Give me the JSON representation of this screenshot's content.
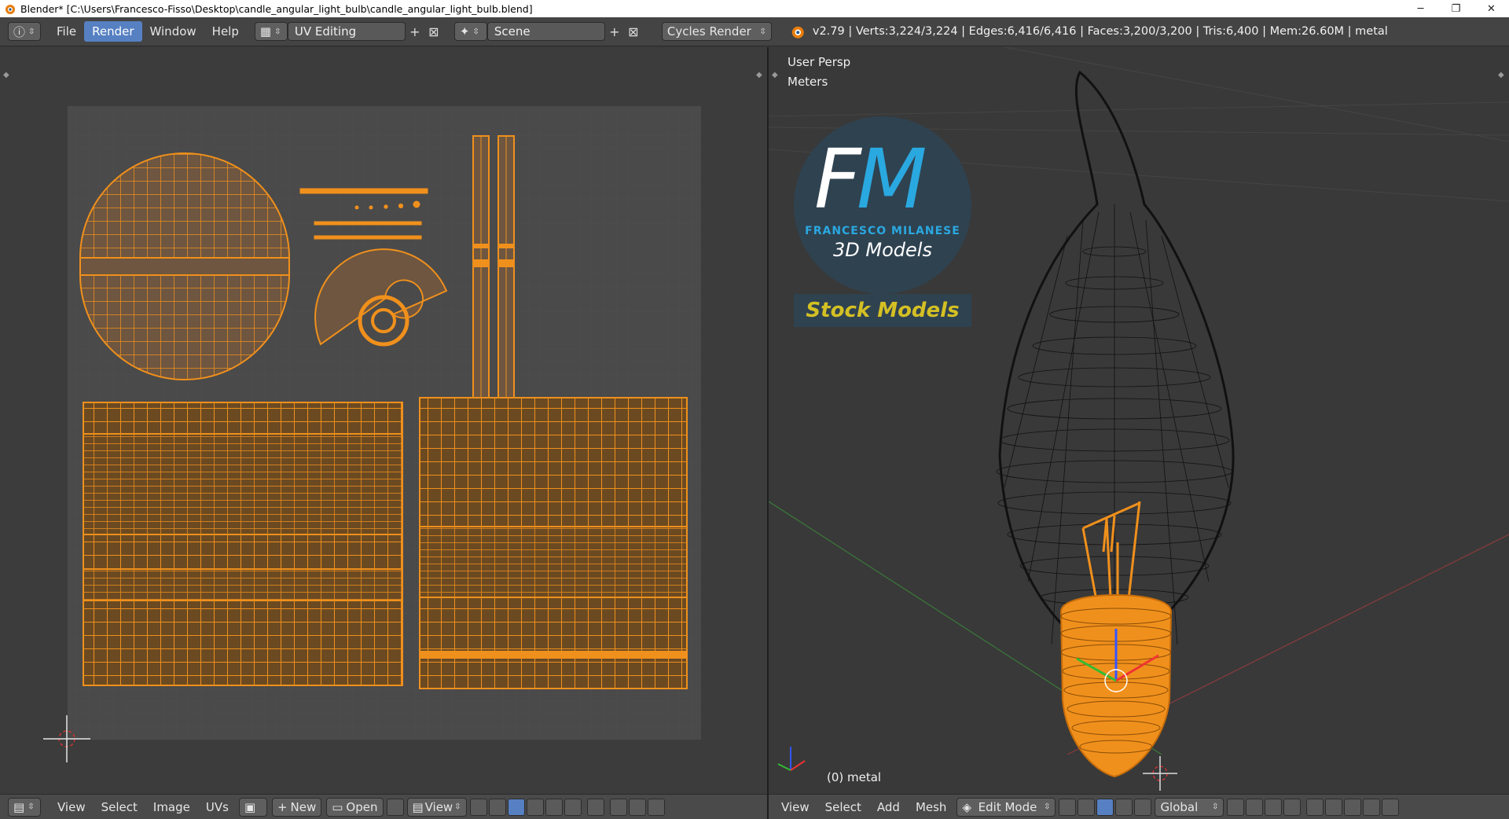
{
  "window": {
    "title": "Blender* [C:\\Users\\Francesco-Fisso\\Desktop\\candle_angular_light_bulb\\candle_angular_light_bulb.blend]",
    "minimize_glyph": "─",
    "maximize_glyph": "❐",
    "close_glyph": "✕"
  },
  "topbar": {
    "menus": [
      "File",
      "Render",
      "Window",
      "Help"
    ],
    "screen_layout": "UV Editing",
    "scene": "Scene",
    "render_engine": "Cycles Render",
    "stats": "v2.79 | Verts:3,224/3,224 | Edges:6,416/6,416 | Faces:3,200/3,200 | Tris:6,400 | Mem:26.60M | metal"
  },
  "uv_editor": {
    "menus": [
      "View",
      "Select",
      "Image",
      "UVs"
    ],
    "new_label": "New",
    "open_label": "Open",
    "view_label": "View"
  },
  "viewport": {
    "persp_label": "User Persp",
    "units_label": "Meters",
    "object_label": "(0) metal",
    "menus": [
      "View",
      "Select",
      "Add",
      "Mesh"
    ],
    "mode": "Edit Mode",
    "orientation": "Global"
  },
  "logo": {
    "letters_f": "F",
    "letters_m": "M",
    "name": "FRANCESCO MILANESE",
    "tagline": "3D Models",
    "stock": "Stock Models"
  },
  "colors": {
    "accent": "#5680c2",
    "uv_orange": "#f0901c",
    "wire_black": "#111111"
  }
}
